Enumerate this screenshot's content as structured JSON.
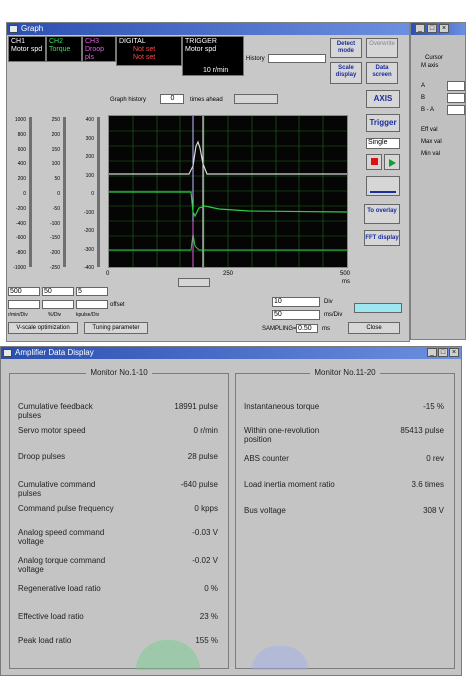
{
  "graph": {
    "title": "Graph",
    "ch1": {
      "label": "CH1",
      "value": "Motor spd"
    },
    "ch2": {
      "label": "CH2",
      "value": "Torque"
    },
    "ch3": {
      "label": "CH3",
      "value": "Droop pls"
    },
    "digital": {
      "label": "DIGITAL",
      "items": [
        "Not set",
        "Not set",
        "Not set"
      ]
    },
    "trigger": {
      "label": "TRIGGER",
      "value": "Motor spd",
      "level": "10 r/min"
    },
    "history_label": "History",
    "buttons": {
      "detect_mode": "Detect mode",
      "overwrite": "Overwrite",
      "scope_display": "Scale display",
      "data_screen": "Data screen",
      "axis": "AXIS",
      "trigger": "Trigger",
      "single": "Single",
      "to_overlay": "To overlay",
      "fft": "FFT display",
      "close": "Close",
      "vscale": "V-scale optimization",
      "tuning": "Tuning parameter"
    },
    "graph_history_label": "Graph history",
    "graph_history_value": "0",
    "times_ahead": "times ahead",
    "x_ticks": [
      "0",
      "250",
      "500"
    ],
    "x_unit": "ms",
    "scale_units": [
      "r/min/Div",
      "%/Div",
      "kpulse/Div"
    ],
    "scale_selects": [
      "500",
      "50",
      "5"
    ],
    "offset_label": "offset",
    "div_label": "Div",
    "ms_div_label": "ms/Div",
    "sampling_label": "SAMPLING=",
    "sampling_value": "0.50",
    "sampling_unit": "ms",
    "time_select1": "10",
    "time_select2": "50",
    "cursor": {
      "label": "Cursor",
      "option": "M axis",
      "a": "A",
      "b": "B",
      "ba": "B - A"
    },
    "cursor_extra": [
      "Eff val",
      "Max val",
      "Min val"
    ]
  },
  "amp": {
    "title": "Amplifier Data Display",
    "monitor1": {
      "title": "Monitor No.1-10",
      "rows": [
        {
          "label": "Cumulative feedback pulses",
          "value": "18991 pulse"
        },
        {
          "label": "Servo motor speed",
          "value": "0 r/min"
        },
        {
          "label": "Droop pulses",
          "value": "28 pulse"
        },
        {
          "label": "Cumulative command pulses",
          "value": "-640 pulse"
        },
        {
          "label": "Command pulse frequency",
          "value": "0 kpps"
        },
        {
          "label": "Analog speed command voltage",
          "value": "-0.03 V"
        },
        {
          "label": "Analog torque command voltage",
          "value": "-0.02 V"
        },
        {
          "label": "Regenerative load ratio",
          "value": "0 %"
        },
        {
          "label": "Effective load ratio",
          "value": "23 %"
        },
        {
          "label": "Peak load ratio",
          "value": "155 %"
        }
      ]
    },
    "monitor2": {
      "title": "Monitor No.11-20",
      "rows": [
        {
          "label": "Instantaneous torque",
          "value": "-15 %"
        },
        {
          "label": "Within one-revolution position",
          "value": "85413 pulse"
        },
        {
          "label": "ABS counter",
          "value": "0 rev"
        },
        {
          "label": "Load inertia moment ratio",
          "value": "3.6 times"
        },
        {
          "label": "Bus voltage",
          "value": "308 V"
        }
      ]
    }
  },
  "scales": {
    "ticks1": [
      "1000",
      "800",
      "600",
      "400",
      "200",
      "0",
      "-200",
      "-400",
      "-600",
      "-800",
      "-1000"
    ],
    "ticks2": [
      "250",
      "200",
      "150",
      "100",
      "50",
      "0",
      "-50",
      "-100",
      "-150",
      "-200",
      "-250"
    ],
    "ticks3": [
      "400",
      "300",
      "200",
      "100",
      "0",
      "-100",
      "-200",
      "-300",
      "-400"
    ]
  },
  "colors": {
    "trace_white": "#d8d8d8",
    "trace_green": "#2ecc40",
    "grid": "#1e6b1e",
    "badge": "#6fd08c",
    "badge2": "#9fb0f0"
  }
}
